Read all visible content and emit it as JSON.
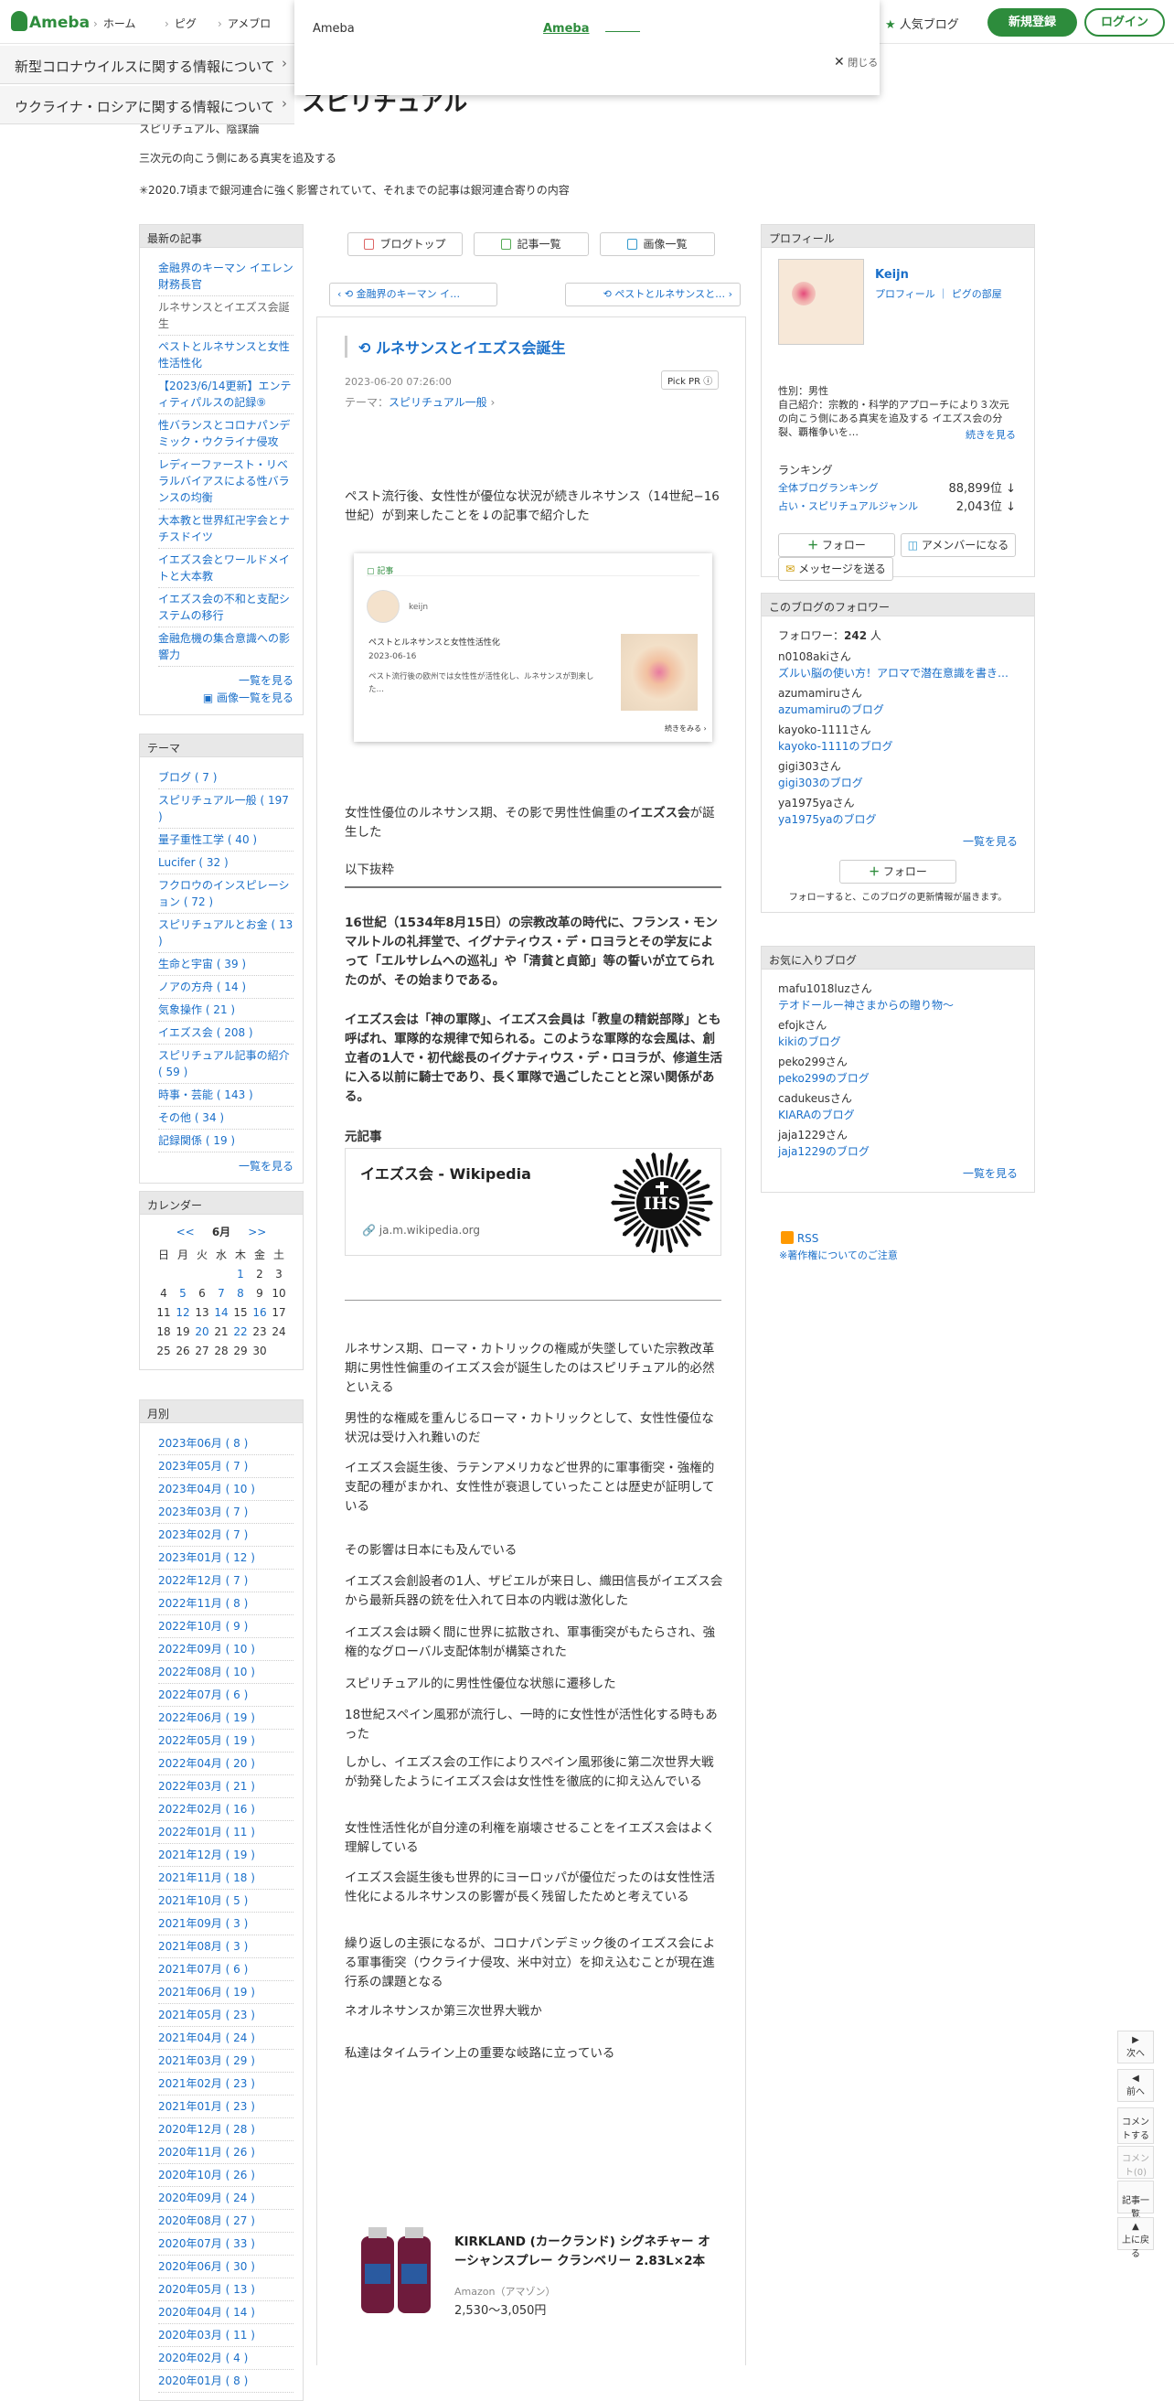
{
  "header": {
    "brand": "Ameba",
    "nav": [
      "ホーム",
      "ピグ",
      "アメブロ"
    ],
    "popular": "人気ブログ",
    "signup": "新規登録",
    "login": "ログイン"
  },
  "popup": {
    "title": "Ameba",
    "link": "Ameba",
    "close": "閉じる"
  },
  "notices": [
    "新型コロナウイルスに関する情報について",
    "ウクライナ・ロシアに関する情報について"
  ],
  "blog": {
    "title": "スピリチュアル",
    "desc": [
      "スピリチュアル、陰謀論",
      "三次元の向こう側にある真実を追及する",
      "✳︎2020.7頃まで銀河連合に強く影響されていて、それまでの記事は銀河連合寄りの内容"
    ]
  },
  "recent": {
    "heading": "最新の記事",
    "items": [
      "金融界のキーマン イエレン財務長官",
      "ルネサンスとイエズス会誕生",
      "ペストとルネサンスと女性性活性化",
      "【2023/6/14更新】エンティティパルスの記録⑨",
      "性バランスとコロナパンデミック・ウクライナ侵攻",
      "レディーファースト・リベラルバイアスによる性バランスの均衡",
      "大本教と世界紅卍字会とナチスドイツ",
      "イエズス会とワールドメイトと大本教",
      "イエズス会の不和と支配システムの移行",
      "金融危機の集合意識への影響力"
    ],
    "more": "一覧を見る",
    "images": "画像一覧を見る"
  },
  "themes": {
    "heading": "テーマ",
    "items": [
      "ブログ ( 7 )",
      "スピリチュアル一般 ( 197 )",
      "量子重性工学 ( 40 )",
      "Lucifer ( 32 )",
      "フクロウのインスピレーション ( 72 )",
      "スピリチュアルとお金 ( 13 )",
      "生命と宇宙 ( 39 )",
      "ノアの方舟 ( 14 )",
      "気象操作 ( 21 )",
      "イエズス会 ( 208 )",
      "スピリチュアル記事の紹介 ( 59 )",
      "時事・芸能 ( 143 )",
      "その他 ( 34 )",
      "記録関係 ( 19 )"
    ],
    "more": "一覧を見る"
  },
  "calendar": {
    "heading": "カレンダー",
    "prev": "<<",
    "month": "6月",
    "next": ">>",
    "weekdays": [
      "日",
      "月",
      "火",
      "水",
      "木",
      "金",
      "土"
    ],
    "weeks": [
      [
        "",
        "",
        "",
        "",
        "1",
        "2",
        "3"
      ],
      [
        "4",
        "5",
        "6",
        "7",
        "8",
        "9",
        "10"
      ],
      [
        "11",
        "12",
        "13",
        "14",
        "15",
        "16",
        "17"
      ],
      [
        "18",
        "19",
        "20",
        "21",
        "22",
        "23",
        "24"
      ],
      [
        "25",
        "26",
        "27",
        "28",
        "29",
        "30",
        ""
      ]
    ],
    "linked": [
      "1",
      "5",
      "7",
      "8",
      "12",
      "14",
      "16",
      "20",
      "22"
    ]
  },
  "monthly": {
    "heading": "月別",
    "items": [
      "2023年06月 ( 8 )",
      "2023年05月 ( 7 )",
      "2023年04月 ( 10 )",
      "2023年03月 ( 7 )",
      "2023年02月 ( 7 )",
      "2023年01月 ( 12 )",
      "2022年12月 ( 7 )",
      "2022年11月 ( 8 )",
      "2022年10月 ( 9 )",
      "2022年09月 ( 10 )",
      "2022年08月 ( 10 )",
      "2022年07月 ( 6 )",
      "2022年06月 ( 19 )",
      "2022年05月 ( 19 )",
      "2022年04月 ( 20 )",
      "2022年03月 ( 21 )",
      "2022年02月 ( 16 )",
      "2022年01月 ( 11 )",
      "2021年12月 ( 19 )",
      "2021年11月 ( 18 )",
      "2021年10月 ( 5 )",
      "2021年09月 ( 3 )",
      "2021年08月 ( 3 )",
      "2021年07月 ( 6 )",
      "2021年06月 ( 19 )",
      "2021年05月 ( 23 )",
      "2021年04月 ( 24 )",
      "2021年03月 ( 29 )",
      "2021年02月 ( 23 )",
      "2021年01月 ( 23 )",
      "2020年12月 ( 28 )",
      "2020年11月 ( 26 )",
      "2020年10月 ( 26 )",
      "2020年09月 ( 24 )",
      "2020年08月 ( 27 )",
      "2020年07月 ( 33 )",
      "2020年06月 ( 30 )",
      "2020年05月 ( 13 )",
      "2020年04月 ( 14 )",
      "2020年03月 ( 11 )",
      "2020年02月 ( 4 )",
      "2020年01月 ( 8 )"
    ]
  },
  "toolbar": {
    "top": "ブログトップ",
    "list": "記事一覧",
    "images": "画像一覧"
  },
  "pager": {
    "prev": "金融界のキーマン イ…",
    "next": "ペストとルネサンスと…"
  },
  "article": {
    "title": "ルネサンスとイエズス会誕生",
    "date": "2023-06-20 07:26:00",
    "pickpr": "Pick PR ⓘ",
    "theme_label": "テーマ：",
    "theme": "スピリチュアル一般",
    "p1": "ペスト流行後、女性性が優位な状況が続きルネサンス（14世紀−16世紀）が到来したことを↓の記事で紹介した",
    "embed": {
      "tag": "記事",
      "author": "keijn",
      "title": "ペストとルネサンスと女性性活性化",
      "date": "2023-06-16",
      "text": "ペスト流行後の欧州では女性性が活性化し、ルネサンスが到来した…",
      "more": "続きをみる"
    },
    "p2a": "女性性優位のルネサンス期、その影で男性性偏重の",
    "p2b": "イエズス会",
    "p2c": "が誕生した",
    "quote_label": "以下抜粋",
    "q1": "16世紀（1534年8月15日）の宗教改革の時代に、フランス・モンマルトルの礼拝堂で、イグナティウス・デ・ロヨラとその学友によって「エルサレムへの巡礼」や「清貧と貞節」等の誓いが立てられたのが、その始まりである。",
    "q2": "イエズス会は「神の軍隊」、イエズス会員は「教皇の精鋭部隊」とも呼ばれ、軍隊的な規律で知られる。このような軍隊的な会風は、創立者の1人で・初代総長のイグナティウス・デ・ロヨラが、修道生活に入る以前に騎士であり、長く軍隊で過ごしたことと深い関係がある。",
    "source_label": "元記事",
    "wiki_title": "イエズス会 - Wikipedia",
    "wiki_url": "ja.m.wikipedia.org",
    "wiki_seal": "IHS",
    "body": [
      "ルネサンス期、ローマ・カトリックの権威が失墜していた宗教改革期に男性性偏重のイエズス会が誕生したのはスピリチュアル的必然といえる",
      "男性的な権威を重んじるローマ・カトリックとして、女性性優位な状況は受け入れ難いのだ",
      "イエズス会誕生後、ラテンアメリカなど世界的に軍事衝突・強権的支配の種がまかれ、女性性が衰退していったことは歴史が証明している",
      "その影響は日本にも及んでいる",
      "イエズス会創設者の1人、ザビエルが来日し、織田信長がイエズス会から最新兵器の銃を仕入れて日本の内戦は激化した",
      "イエズス会は瞬く間に世界に拡散され、軍事衝突がもたらされ、強権的なグローバル支配体制が構築された",
      "スピリチュアル的に男性性優位な状態に遷移した",
      "18世紀スペイン風邪が流行し、一時的に女性性が活性化する時もあった",
      "しかし、イエズス会の工作によりスペイン風邪後に第二次世界大戦が勃発したようにイエズス会は女性性を徹底的に抑え込んでいる",
      "女性性活性化が自分達の利権を崩壊させることをイエズス会はよく理解している",
      "イエズス会誕生後も世界的にヨーロッパが優位だったのは女性性活性化によるルネサンスの影響が長く残留したためと考えている",
      "繰り返しの主張になるが、コロナパンデミック後のイエズス会による軍事衝突（ウクライナ侵攻、米中対立）を抑え込むことが現在進行系の課題となる",
      "ネオルネサンスか第三次世界大戦か",
      "私達はタイムライン上の重要な岐路に立っている"
    ],
    "ad_title": "KIRKLAND (カークランド) シグネチャー オーシャンスプレー クランベリー 2.83L×2本",
    "ad_shop": "Amazon（アマゾン）",
    "ad_price": "2,530〜3,050円"
  },
  "profile": {
    "heading": "プロフィール",
    "name": "Keijn",
    "links": [
      "プロフィール",
      "ピグの部屋"
    ],
    "gender": "性別：男性",
    "intro": "自己紹介：宗教的・科学的アプローチにより３次元の向こう側にある真実を追及する イエズス会の分裂、覇権争いを…",
    "more": "続きを見る",
    "ranking_label": "ランキング",
    "rank1_label": "全体ブログランキング",
    "rank1": "88,899位 ↓",
    "rank2_label": "占い・スピリチュアルジャンル",
    "rank2": "2,043位 ↓",
    "follow": "フォロー",
    "amember": "アメンバーになる",
    "message": "メッセージを送る"
  },
  "followers": {
    "heading": "このブログのフォロワー",
    "count_label": "フォロワー：",
    "count": "242",
    "unit": "人",
    "items": [
      {
        "name": "n0108akiさん",
        "blog": "ズルい脳の使い方！アロマで潜在意識を書き…"
      },
      {
        "name": "azumamiruさん",
        "blog": "azumamiruのブログ"
      },
      {
        "name": "kayoko-1111さん",
        "blog": "kayoko-1111のブログ"
      },
      {
        "name": "gigi303さん",
        "blog": "gigi303のブログ"
      },
      {
        "name": "ya1975yaさん",
        "blog": "ya1975yaのブログ"
      }
    ],
    "more": "一覧を見る",
    "follow": "フォロー",
    "note": "フォローすると、このブログの更新情報が届きます。"
  },
  "favorites": {
    "heading": "お気に入りブログ",
    "items": [
      {
        "name": "mafu1018luzさん",
        "blog": "テオドールー神さまからの贈り物〜"
      },
      {
        "name": "efojkさん",
        "blog": "kikiのブログ"
      },
      {
        "name": "peko299さん",
        "blog": "peko299のブログ"
      },
      {
        "name": "cadukeusさん",
        "blog": "KIARAのブログ"
      },
      {
        "name": "jaja1229さん",
        "blog": "jaja1229のブログ"
      }
    ],
    "more": "一覧を見る"
  },
  "rss": {
    "label": "RSS",
    "note": "※著作権についてのご注意"
  },
  "rightnav": [
    "次へ",
    "前へ",
    "コメントする",
    "コメント(0)",
    "記事一覧",
    "上に戻る"
  ],
  "colors": {
    "brand": "#2d8c3c",
    "link": "#1a6fc9"
  }
}
